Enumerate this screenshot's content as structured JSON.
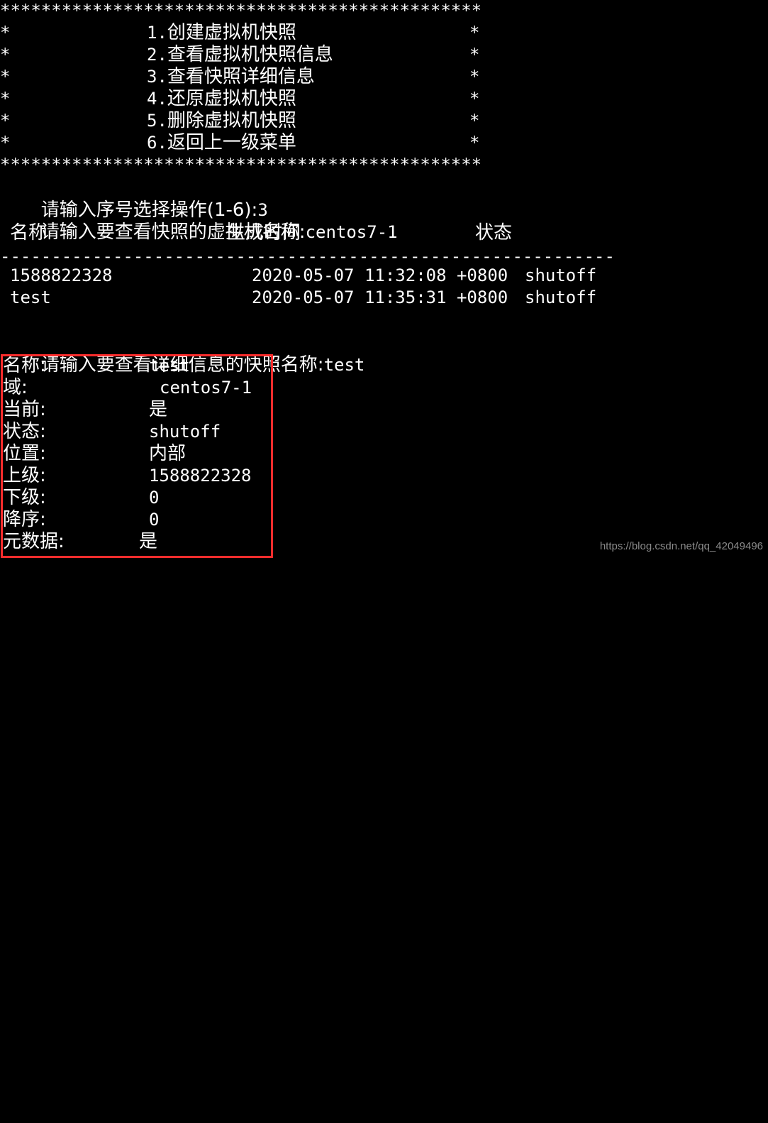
{
  "terminal": {
    "background_color": "#000000",
    "foreground_color": "#ffffff",
    "highlight_color": "#ff2d2d"
  },
  "menu": {
    "border_top": "***********************************************",
    "border_bottom": "***********************************************",
    "frame_char": "*",
    "items": [
      {
        "number": "1.",
        "label": "创建虚拟机快照"
      },
      {
        "number": "2.",
        "label": "查看虚拟机快照信息"
      },
      {
        "number": "3.",
        "label": "查看快照详细信息"
      },
      {
        "number": "4.",
        "label": "还原虚拟机快照"
      },
      {
        "number": "5.",
        "label": "删除虚拟机快照"
      },
      {
        "number": "6.",
        "label": "返回上一级菜单"
      }
    ]
  },
  "prompts": [
    {
      "text": "请输入序号选择操作(1-6):",
      "value": "3"
    },
    {
      "text": "请输入要查看快照的虚拟机名称:",
      "value": "centos7-1"
    }
  ],
  "snapshot_table": {
    "headers": {
      "name": "名称",
      "creation_time": "生成时间",
      "state": "状态"
    },
    "separator": "------------------------------------------------------------",
    "rows": [
      {
        "name": "1588822328",
        "creation_time": "2020-05-07 11:32:08 +0800",
        "state": "shutoff"
      },
      {
        "name": "test",
        "creation_time": "2020-05-07 11:35:31 +0800",
        "state": "shutoff"
      }
    ]
  },
  "detail_prompt": {
    "text": "请输入要查看详细信息的快照名称:",
    "value": "test"
  },
  "snapshot_detail": {
    "rows": [
      {
        "label": "名称:",
        "value": "test",
        "value_type": "ascii"
      },
      {
        "label": "域:",
        "value": "centos7-1",
        "value_type": "ascii"
      },
      {
        "label": "当前:",
        "value": "是",
        "value_type": "cjk"
      },
      {
        "label": "状态:",
        "value": "shutoff",
        "value_type": "ascii"
      },
      {
        "label": "位置:",
        "value": "内部",
        "value_type": "cjk"
      },
      {
        "label": "上级:",
        "value": "1588822328",
        "value_type": "ascii"
      },
      {
        "label": "下级:",
        "value": "0",
        "value_type": "ascii"
      },
      {
        "label": "降序:",
        "value": "0",
        "value_type": "ascii"
      },
      {
        "label": "元数据:",
        "value": "是",
        "value_type": "cjk"
      }
    ]
  },
  "watermark": "https://blog.csdn.net/qq_42049496"
}
